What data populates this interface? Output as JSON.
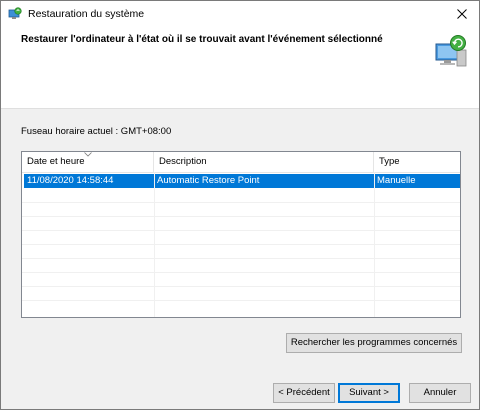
{
  "window": {
    "title": "Restauration du système"
  },
  "header": {
    "title": "Restaurer l'ordinateur à l'état où il se trouvait avant l'événement sélectionné"
  },
  "timezone": {
    "label": "Fuseau horaire actuel : GMT+08:00"
  },
  "restore_list": {
    "columns": [
      "Date et heure",
      "Description",
      "Type"
    ],
    "rows": [
      {
        "date": "11/08/2020 14:58:44",
        "description": "Automatic Restore Point",
        "type": "Manuelle",
        "selected": true
      }
    ]
  },
  "buttons": {
    "scan": "Rechercher les programmes concernés",
    "back": "< Précédent",
    "next": "Suivant >",
    "cancel": "Annuler"
  },
  "colors": {
    "selection": "#0078d7",
    "window_bg": "#f0f0f0"
  }
}
